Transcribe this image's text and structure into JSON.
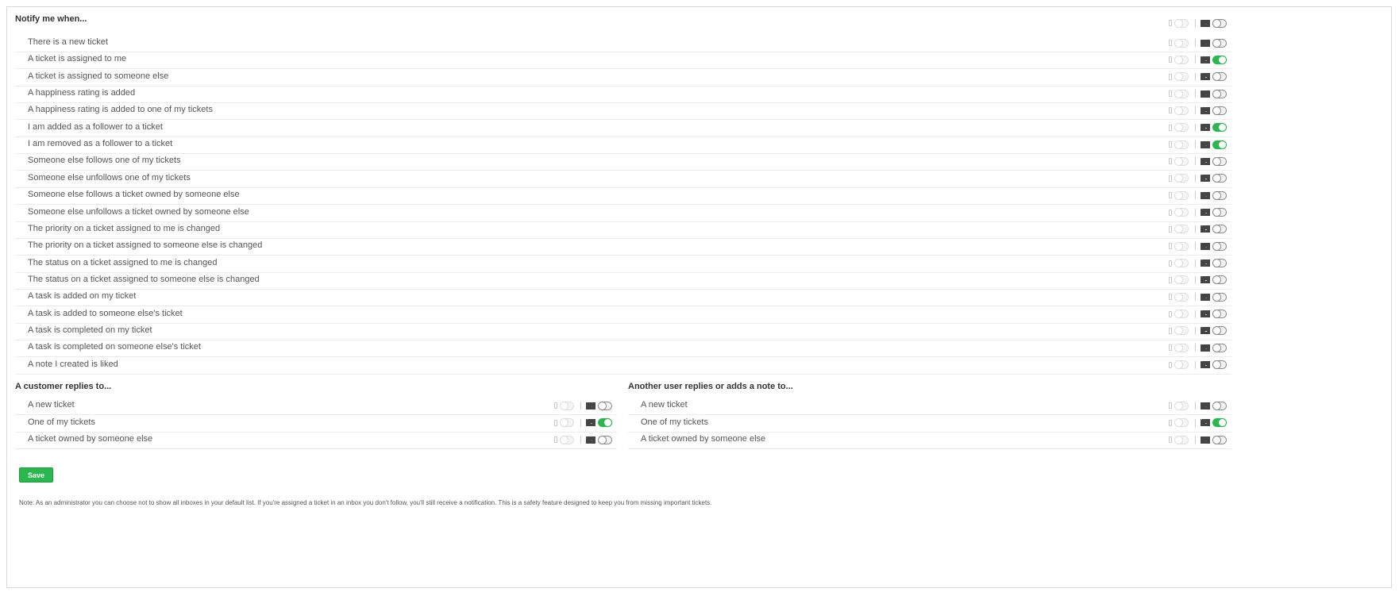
{
  "notify": {
    "title": "Notify me when...",
    "header_toggles": {
      "sms_on": false,
      "email_on": false
    },
    "rows": [
      {
        "label": "There is a new ticket",
        "sms_on": false,
        "email_on": false
      },
      {
        "label": "A ticket is assigned to me",
        "sms_on": false,
        "email_on": true
      },
      {
        "label": "A ticket is assigned to someone else",
        "sms_on": false,
        "email_on": false
      },
      {
        "label": "A happiness rating is added",
        "sms_on": false,
        "email_on": false
      },
      {
        "label": "A happiness rating is added to one of my tickets",
        "sms_on": false,
        "email_on": false
      },
      {
        "label": "I am added as a follower to a ticket",
        "sms_on": false,
        "email_on": true
      },
      {
        "label": "I am removed as a follower to a ticket",
        "sms_on": false,
        "email_on": true
      },
      {
        "label": "Someone else follows one of my tickets",
        "sms_on": false,
        "email_on": false
      },
      {
        "label": "Someone else unfollows one of my tickets",
        "sms_on": false,
        "email_on": false
      },
      {
        "label": "Someone else follows a ticket owned by someone else",
        "sms_on": false,
        "email_on": false
      },
      {
        "label": "Someone else unfollows a ticket owned by someone else",
        "sms_on": false,
        "email_on": false
      },
      {
        "label": "The priority on a ticket assigned to me is changed",
        "sms_on": false,
        "email_on": false
      },
      {
        "label": "The priority on a ticket assigned to someone else is changed",
        "sms_on": false,
        "email_on": false
      },
      {
        "label": "The status on a ticket assigned to me is changed",
        "sms_on": false,
        "email_on": false
      },
      {
        "label": "The status on a ticket assigned to someone else is changed",
        "sms_on": false,
        "email_on": false
      },
      {
        "label": "A task is added on my ticket",
        "sms_on": false,
        "email_on": false
      },
      {
        "label": "A task is added to someone else's ticket",
        "sms_on": false,
        "email_on": false
      },
      {
        "label": "A task is completed on my ticket",
        "sms_on": false,
        "email_on": false
      },
      {
        "label": "A task is completed on someone else's ticket",
        "sms_on": false,
        "email_on": false
      },
      {
        "label": "A note I created is liked",
        "sms_on": false,
        "email_on": false
      }
    ]
  },
  "customer_replies": {
    "title": "A customer replies to...",
    "rows": [
      {
        "label": "A new ticket",
        "sms_on": false,
        "email_on": false
      },
      {
        "label": "One of my tickets",
        "sms_on": false,
        "email_on": true
      },
      {
        "label": "A ticket owned by someone else",
        "sms_on": false,
        "email_on": false
      }
    ]
  },
  "user_replies": {
    "title": "Another user replies or adds a note to...",
    "rows": [
      {
        "label": "A new ticket",
        "sms_on": false,
        "email_on": false
      },
      {
        "label": "One of my tickets",
        "sms_on": false,
        "email_on": true
      },
      {
        "label": "A ticket owned by someone else",
        "sms_on": false,
        "email_on": false
      }
    ]
  },
  "save_label": "Save",
  "note_text": "Note: As an administrator you can choose not to show all inboxes in your default list. If you're assigned a ticket in an inbox you don't follow, you'll still receive a notification. This is a safety feature designed to keep you from missing important tickets.",
  "colors": {
    "toggle_on": "#2ab74d",
    "save_button": "#2ab74d"
  },
  "icons": {
    "sms": "mobile-phone-icon",
    "email": "envelope-icon"
  }
}
